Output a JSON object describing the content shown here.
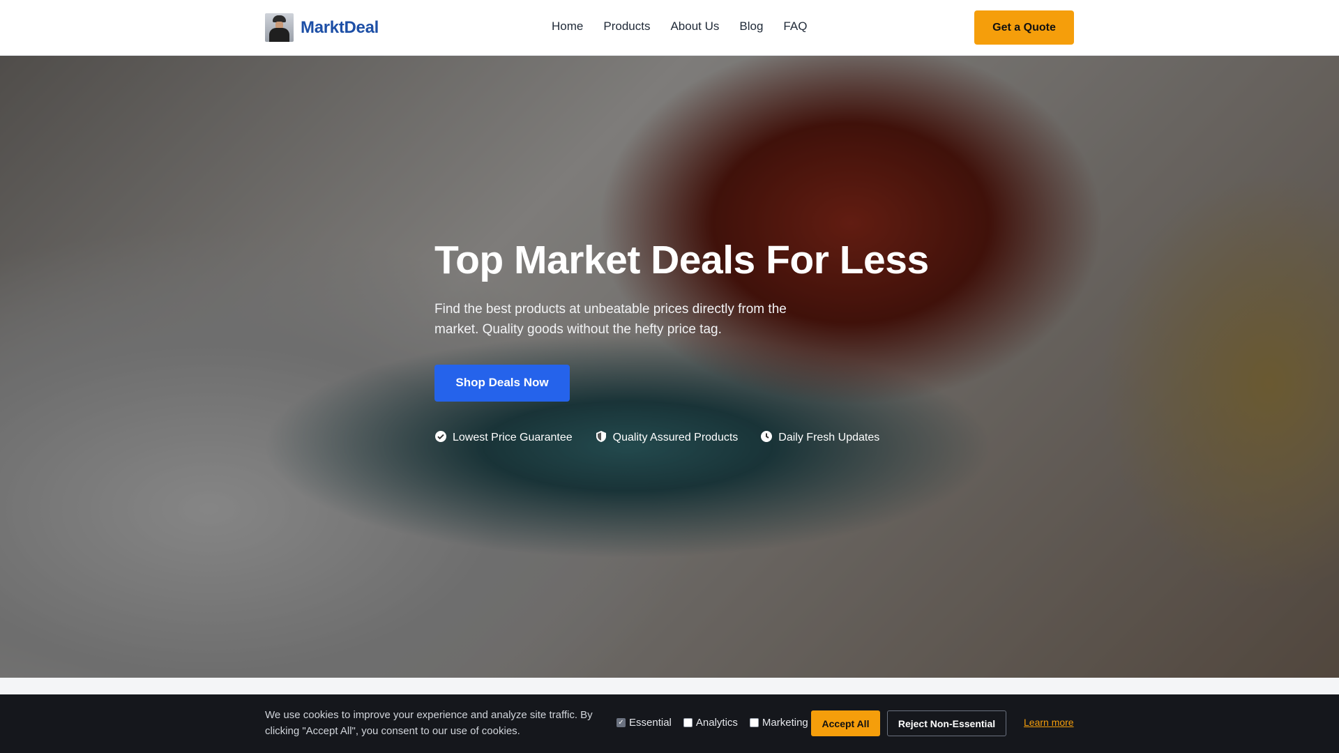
{
  "header": {
    "logo_text": "MarktDeal",
    "nav": [
      "Home",
      "Products",
      "About Us",
      "Blog",
      "FAQ"
    ],
    "cta_label": "Get a Quote"
  },
  "hero": {
    "title": "Top Market Deals For Less",
    "subtitle": "Find the best products at unbeatable prices directly from the market. Quality goods without the hefty price tag.",
    "button_label": "Shop Deals Now",
    "features": [
      {
        "icon": "check-circle-icon",
        "label": "Lowest Price Guarantee"
      },
      {
        "icon": "shield-icon",
        "label": "Quality Assured Products"
      },
      {
        "icon": "clock-icon",
        "label": "Daily Fresh Updates"
      }
    ]
  },
  "cookie": {
    "text": "We use cookies to improve your experience and analyze site traffic. By clicking \"Accept All\", you consent to our use of cookies.",
    "options": [
      {
        "label": "Essential",
        "checked": true
      },
      {
        "label": "Analytics",
        "checked": false
      },
      {
        "label": "Marketing",
        "checked": false
      }
    ],
    "accept_label": "Accept All",
    "reject_label": "Reject Non-Essential",
    "learn_label": "Learn more"
  },
  "colors": {
    "brand": "#1d4fa6",
    "accent": "#f59e0b",
    "primary": "#2563eb",
    "banner": "#15171c"
  }
}
